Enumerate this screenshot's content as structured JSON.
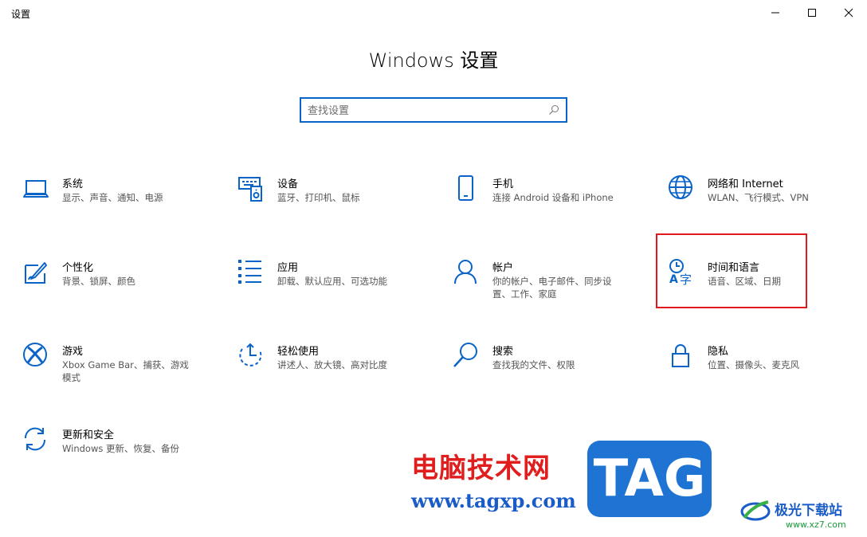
{
  "window": {
    "app_title": "设置"
  },
  "header": {
    "title": "Windows 设置"
  },
  "search": {
    "placeholder": "查找设置"
  },
  "tiles": [
    {
      "title": "系统",
      "desc": "显示、声音、通知、电源",
      "icon": "laptop-icon"
    },
    {
      "title": "设备",
      "desc": "蓝牙、打印机、鼠标",
      "icon": "devices-icon"
    },
    {
      "title": "手机",
      "desc": "连接 Android 设备和 iPhone",
      "icon": "phone-icon"
    },
    {
      "title": "网络和 Internet",
      "desc": "WLAN、飞行模式、VPN",
      "icon": "globe-icon"
    },
    {
      "title": "个性化",
      "desc": "背景、锁屏、颜色",
      "icon": "paint-icon"
    },
    {
      "title": "应用",
      "desc": "卸载、默认应用、可选功能",
      "icon": "apps-list-icon"
    },
    {
      "title": "帐户",
      "desc": "你的帐户、电子邮件、同步设置、工作、家庭",
      "icon": "person-icon"
    },
    {
      "title": "时间和语言",
      "desc": "语音、区域、日期",
      "icon": "time-language-icon"
    },
    {
      "title": "游戏",
      "desc": "Xbox Game Bar、捕获、游戏模式",
      "icon": "xbox-icon"
    },
    {
      "title": "轻松使用",
      "desc": "讲述人、放大镜、高对比度",
      "icon": "ease-of-access-icon"
    },
    {
      "title": "搜索",
      "desc": "查找我的文件、权限",
      "icon": "search-icon"
    },
    {
      "title": "隐私",
      "desc": "位置、摄像头、麦克风",
      "icon": "lock-icon"
    },
    {
      "title": "更新和安全",
      "desc": "Windows 更新、恢复、备份",
      "icon": "sync-icon"
    }
  ],
  "watermark": {
    "site_cn": "电脑技术网",
    "site_url": "www.tagxp.com",
    "tag": "TAG",
    "brand_cn": "极光下载站",
    "brand_url": "www.xz7.com"
  },
  "colors": {
    "accent": "#0a64c8",
    "highlight": "#e0191e"
  }
}
